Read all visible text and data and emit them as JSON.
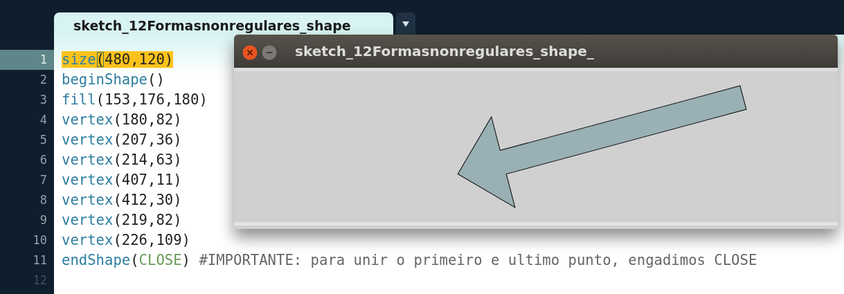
{
  "editor": {
    "tab": {
      "title": "sketch_12Formasnonregulares_shape",
      "selected": true
    },
    "lines": [
      {
        "number": "1",
        "selected": true,
        "tokens": [
          {
            "text": "size",
            "kind": "function",
            "highlighted": true
          },
          {
            "text": "(",
            "kind": "bracket-match",
            "highlighted": true
          },
          {
            "text": "480,120)",
            "kind": "plain",
            "highlighted": true
          }
        ]
      },
      {
        "number": "2",
        "selected": false,
        "tokens": [
          {
            "text": "beginShape",
            "kind": "function",
            "highlighted": false
          },
          {
            "text": "()",
            "kind": "plain",
            "highlighted": false
          }
        ]
      },
      {
        "number": "3",
        "selected": false,
        "tokens": [
          {
            "text": "fill",
            "kind": "function",
            "highlighted": false
          },
          {
            "text": "(153,176,180)",
            "kind": "plain",
            "highlighted": false
          }
        ]
      },
      {
        "number": "4",
        "selected": false,
        "tokens": [
          {
            "text": "vertex",
            "kind": "function",
            "highlighted": false
          },
          {
            "text": "(180,82)",
            "kind": "plain",
            "highlighted": false
          }
        ]
      },
      {
        "number": "5",
        "selected": false,
        "tokens": [
          {
            "text": "vertex",
            "kind": "function",
            "highlighted": false
          },
          {
            "text": "(207,36)",
            "kind": "plain",
            "highlighted": false
          }
        ]
      },
      {
        "number": "6",
        "selected": false,
        "tokens": [
          {
            "text": "vertex",
            "kind": "function",
            "highlighted": false
          },
          {
            "text": "(214,63)",
            "kind": "plain",
            "highlighted": false
          }
        ]
      },
      {
        "number": "7",
        "selected": false,
        "tokens": [
          {
            "text": "vertex",
            "kind": "function",
            "highlighted": false
          },
          {
            "text": "(407,11)",
            "kind": "plain",
            "highlighted": false
          }
        ]
      },
      {
        "number": "8",
        "selected": false,
        "tokens": [
          {
            "text": "vertex",
            "kind": "function",
            "highlighted": false
          },
          {
            "text": "(412,30)",
            "kind": "plain",
            "highlighted": false
          }
        ]
      },
      {
        "number": "9",
        "selected": false,
        "tokens": [
          {
            "text": "vertex",
            "kind": "function",
            "highlighted": false
          },
          {
            "text": "(219,82)",
            "kind": "plain",
            "highlighted": false
          }
        ]
      },
      {
        "number": "10",
        "selected": false,
        "tokens": [
          {
            "text": "vertex",
            "kind": "function",
            "highlighted": false
          },
          {
            "text": "(226,109)",
            "kind": "plain",
            "highlighted": false
          }
        ]
      },
      {
        "number": "11",
        "selected": false,
        "tokens": [
          {
            "text": "endShape",
            "kind": "function",
            "highlighted": false
          },
          {
            "text": "(",
            "kind": "plain",
            "highlighted": false
          },
          {
            "text": "CLOSE",
            "kind": "constant",
            "highlighted": false
          },
          {
            "text": ")",
            "kind": "plain",
            "highlighted": false
          },
          {
            "text": " #IMPORTANTE: para unir o primeiro e ultimo punto, engadimos CLOSE",
            "kind": "comment",
            "highlighted": false
          }
        ]
      },
      {
        "number": "12",
        "selected": false
      }
    ]
  },
  "sketch_window": {
    "title": "sketch_12Formasnonregulares_shape_"
  }
}
